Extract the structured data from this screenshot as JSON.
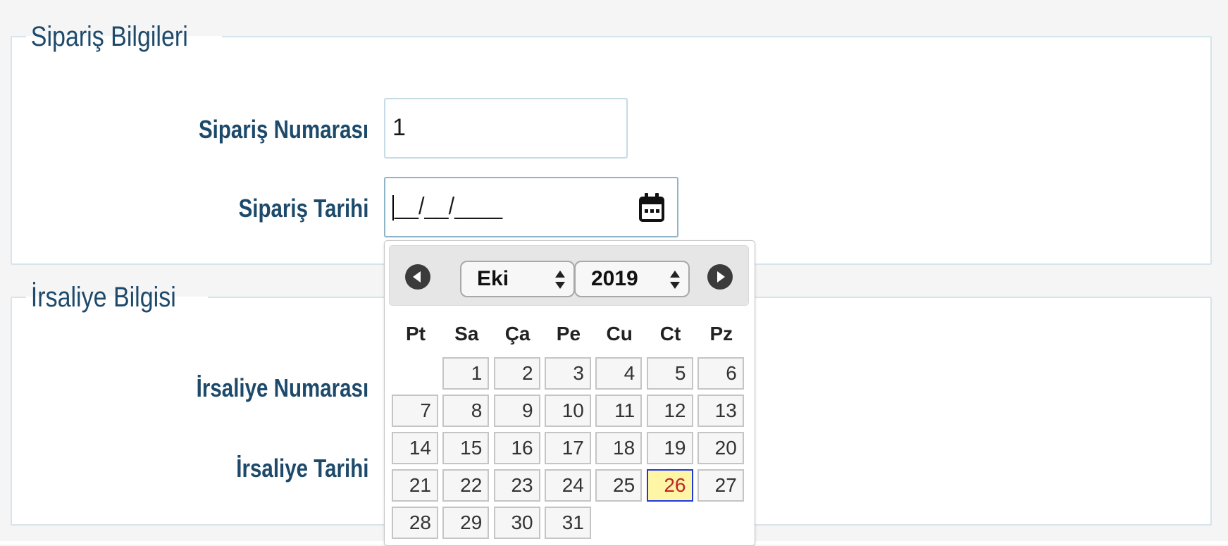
{
  "siparis_section": {
    "legend": "Sipariş Bilgileri",
    "order_number_label": "Sipariş Numarası",
    "order_number_value": "1",
    "order_date_label": "Sipariş Tarihi",
    "order_date_mask": "__/__/____",
    "calendar_icon": "calendar-icon"
  },
  "irsaliye_section": {
    "legend": "İrsaliye Bilgisi",
    "waybill_number_label": "İrsaliye Numarası",
    "waybill_date_label": "İrsaliye Tarihi"
  },
  "datepicker": {
    "prev_icon": "circle-arrow-left-icon",
    "next_icon": "circle-arrow-right-icon",
    "month": "Eki",
    "year": "2019",
    "weekdays": [
      "Pt",
      "Sa",
      "Ça",
      "Pe",
      "Cu",
      "Ct",
      "Pz"
    ],
    "first_weekday_offset": 1,
    "days": [
      "1",
      "2",
      "3",
      "4",
      "5",
      "6",
      "7",
      "8",
      "9",
      "10",
      "11",
      "12",
      "13",
      "14",
      "15",
      "16",
      "17",
      "18",
      "19",
      "20",
      "21",
      "22",
      "23",
      "24",
      "25",
      "26",
      "27",
      "28",
      "29",
      "30",
      "31"
    ],
    "highlighted_day": "26",
    "colors": {
      "today_bg": "#fff6a5",
      "today_border": "#1f39e0",
      "today_text": "#c0232a"
    }
  },
  "colors": {
    "label_text": "#1d4a6b",
    "fieldset_border": "#d6e4ec"
  }
}
